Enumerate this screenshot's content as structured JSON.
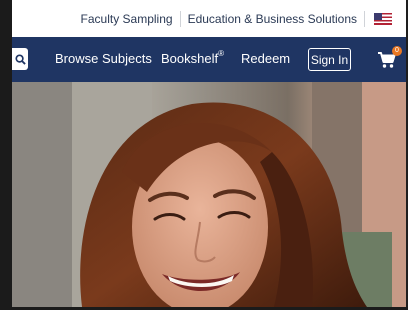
{
  "utility": {
    "faculty_sampling": "Faculty Sampling",
    "education_business": "Education & Business Solutions",
    "flag_icon": "us-flag-icon"
  },
  "nav": {
    "search_icon": "search-icon",
    "browse_subjects": "Browse Subjects",
    "bookshelf": "Bookshelf",
    "bookshelf_mark": "®",
    "redeem": "Redeem",
    "sign_in": "Sign In",
    "cart_icon": "cart-icon",
    "cart_count": "0"
  },
  "colors": {
    "nav_background": "#1f3563",
    "utility_text": "#2b3a55",
    "cart_badge": "#e87722"
  }
}
